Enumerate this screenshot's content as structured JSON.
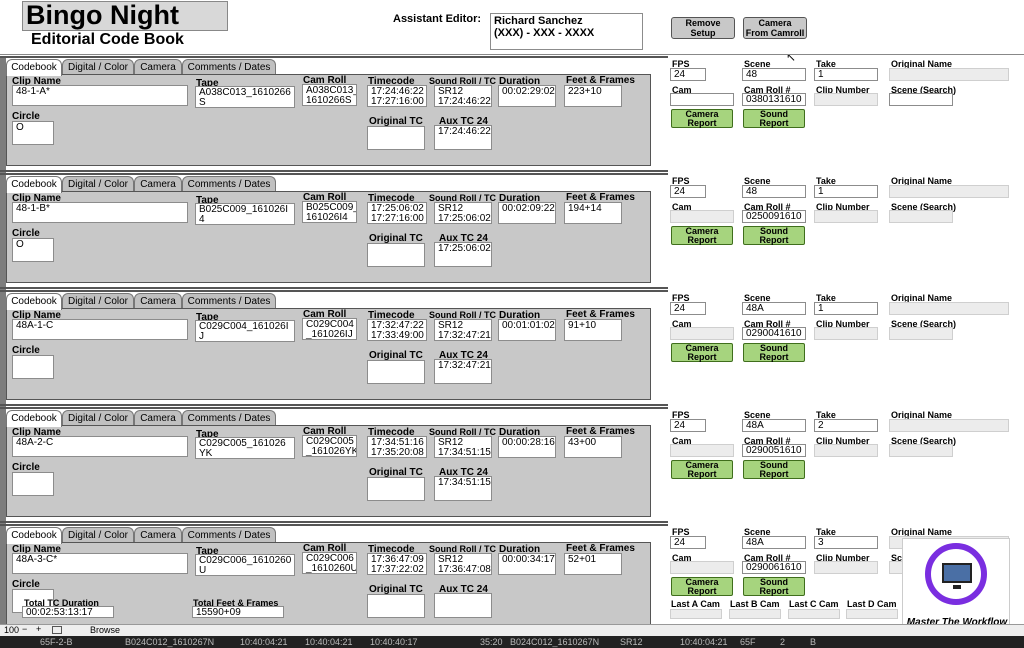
{
  "header": {
    "title": "Bingo Night",
    "subtitle": "Editorial Code Book",
    "assistant_editor_label": "Assistant Editor:",
    "assistant_editor_value": "Richard Sanchez\n(XXX) - XXX - XXXX",
    "remove_setup": "Remove\nSetup",
    "camera_from_camroll": "Camera\nFrom Camroll"
  },
  "tabs": [
    "Codebook",
    "Digital / Color",
    "Camera",
    "Comments / Dates"
  ],
  "labels": {
    "clip_name": "Clip Name",
    "tape": "Tape",
    "cam_roll": "Cam Roll",
    "timecode": "Timecode",
    "sound_roll_tc": "Sound Roll / TC",
    "duration": "Duration",
    "feet_frames": "Feet & Frames",
    "circle": "Circle",
    "original_tc": "Original TC",
    "aux_tc": "Aux TC 24",
    "fps": "FPS",
    "scene": "Scene",
    "take": "Take",
    "original_name": "Original Name",
    "cam": "Cam",
    "cam_roll_num": "Cam Roll #",
    "clip_number": "Clip Number",
    "scene_search": "Scene (Search)",
    "camera_report": "Camera\nReport",
    "sound_report": "Sound\nReport"
  },
  "records": [
    {
      "clip_name": "48-1-A*",
      "tape": "A038C013_1610266\nS",
      "cam_roll": "A038C013_\n1610266S",
      "timecode": "17:24:46:22\n17:27:16:00",
      "sound": "SR12\n17:24:46:22",
      "duration": "00:02:29:02",
      "feet_frames": "223+10",
      "circle": "O",
      "original_tc": "",
      "aux_tc": "17:24:46:22",
      "fps": "24",
      "scene": "48",
      "take": "1",
      "cam": "",
      "cam_roll_num": "0380131610"
    },
    {
      "clip_name": "48-1-B*",
      "tape": "B025C009_161026I\n4",
      "cam_roll": "B025C009_\n161026I4",
      "timecode": "17:25:06:02\n17:27:16:00",
      "sound": "SR12\n17:25:06:02",
      "duration": "00:02:09:22",
      "feet_frames": "194+14",
      "circle": "O",
      "original_tc": "",
      "aux_tc": "17:25:06:02",
      "fps": "24",
      "scene": "48",
      "take": "1",
      "cam": "",
      "cam_roll_num": "0250091610"
    },
    {
      "clip_name": "48A-1-C",
      "tape": "C029C004_161026I\nJ",
      "cam_roll": "C029C004\n_161026IJ",
      "timecode": "17:32:47:22\n17:33:49:00",
      "sound": "SR12\n17:32:47:21",
      "duration": "00:01:01:02",
      "feet_frames": "91+10",
      "circle": "",
      "original_tc": "",
      "aux_tc": "17:32:47:21",
      "fps": "24",
      "scene": "48A",
      "take": "1",
      "cam": "",
      "cam_roll_num": "0290041610"
    },
    {
      "clip_name": "48A-2-C",
      "tape": "C029C005_161026\nYK",
      "cam_roll": "C029C005\n_161026YK",
      "timecode": "17:34:51:16\n17:35:20:08",
      "sound": "SR12\n17:34:51:15",
      "duration": "00:00:28:16",
      "feet_frames": "43+00",
      "circle": "",
      "original_tc": "",
      "aux_tc": "17:34:51:15",
      "fps": "24",
      "scene": "48A",
      "take": "2",
      "cam": "",
      "cam_roll_num": "0290051610"
    },
    {
      "clip_name": "48A-3-C*",
      "tape": "C029C006_1610260\nU",
      "cam_roll": "C029C006\n_1610260U",
      "timecode": "17:36:47:09\n17:37:22:02",
      "sound": "SR12\n17:36:47:08",
      "duration": "00:00:34:17",
      "feet_frames": "52+01",
      "circle": "",
      "original_tc": "",
      "aux_tc": "",
      "fps": "24",
      "scene": "48A",
      "take": "3",
      "cam": "",
      "cam_roll_num": "0290061610"
    }
  ],
  "footer": {
    "total_tc_label": "Total TC Duration",
    "total_tc_value": "00:02:53:13:17",
    "total_ff_label": "Total Feet & Frames",
    "total_ff_value": "15590+09",
    "last_a": "Last A Cam",
    "last_b": "Last B Cam",
    "last_c": "Last C Cam",
    "last_d": "Last D Cam"
  },
  "status": {
    "zoom": "100",
    "mode": "Browse"
  },
  "bottom": [
    "65F-2-B",
    "B024C012_1610267N",
    "10:40:04:21",
    "10:40:04:21",
    "10:40:40:17",
    "35:20",
    "B024C012_1610267N",
    "SR12",
    "10:40:04:21",
    "65F",
    "2",
    "B"
  ],
  "watermark": "Master The Workflow"
}
